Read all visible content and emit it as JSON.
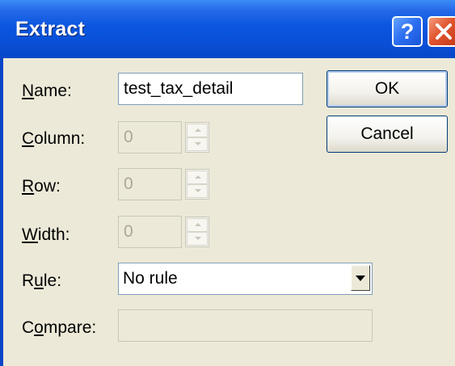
{
  "window": {
    "title": "Extract",
    "help_glyph": "?",
    "close_icon": "close-x-icon"
  },
  "fields": {
    "name": {
      "label_accel": "N",
      "label_rest": "ame:",
      "value": "test_tax_detail"
    },
    "column": {
      "label_accel": "C",
      "label_rest": "olumn:",
      "value": "0"
    },
    "row": {
      "label_accel": "R",
      "label_rest": "ow:",
      "value": "0"
    },
    "width": {
      "label_accel": "W",
      "label_rest": "idth:",
      "value": "0"
    },
    "rule": {
      "label_pre": "R",
      "label_accel": "u",
      "label_rest": "le:",
      "value": "No rule"
    },
    "compare": {
      "label_pre": "C",
      "label_accel": "o",
      "label_rest": "mpare:",
      "value": ""
    }
  },
  "buttons": {
    "ok": "OK",
    "cancel": "Cancel"
  },
  "colors": {
    "titlebar": "#0a56e0",
    "face": "#ece9d8",
    "border": "#7f9db9"
  }
}
